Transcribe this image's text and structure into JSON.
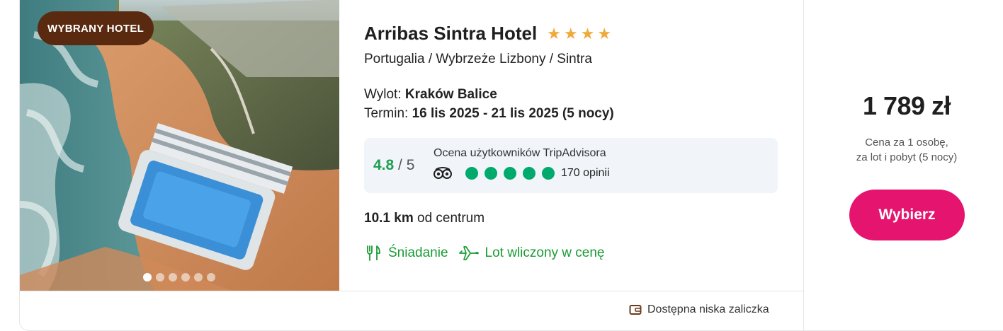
{
  "hotel": {
    "badge": "WYBRANY HOTEL",
    "name": "Arribas Sintra Hotel",
    "stars": 4,
    "location": "Portugalia / Wybrzeże Lizbony / Sintra",
    "departure_label": "Wylot:",
    "departure_value": "Kraków Balice",
    "term_label": "Termin:",
    "term_value": "16 lis 2025 - 21 lis 2025 (5 nocy)",
    "distance_value": "10.1 km",
    "distance_suffix": "od centrum",
    "photo_count": 6,
    "photo_active_index": 0
  },
  "rating": {
    "score": "4.8",
    "max": "/ 5",
    "label": "Ocena użytkowników TripAdvisora",
    "bubbles": 5,
    "reviews": "170 opinii"
  },
  "features": [
    {
      "icon": "cutlery-icon",
      "label": "Śniadanie"
    },
    {
      "icon": "plane-icon",
      "label": "Lot wliczony w cenę"
    }
  ],
  "deposit": {
    "icon": "wallet-icon",
    "label": "Dostępna niska zaliczka"
  },
  "price": {
    "amount": "1 789 zł",
    "note_line1": "Cena za 1 osobę,",
    "note_line2": "za lot i pobyt (5 nocy)",
    "button": "Wybierz"
  },
  "colors": {
    "badge": "#5a2a10",
    "stars": "#f2a93b",
    "rating": "#1f9e52",
    "tripadvisor": "#00aa6c",
    "feature": "#1a9b35",
    "button": "#e5156f"
  }
}
